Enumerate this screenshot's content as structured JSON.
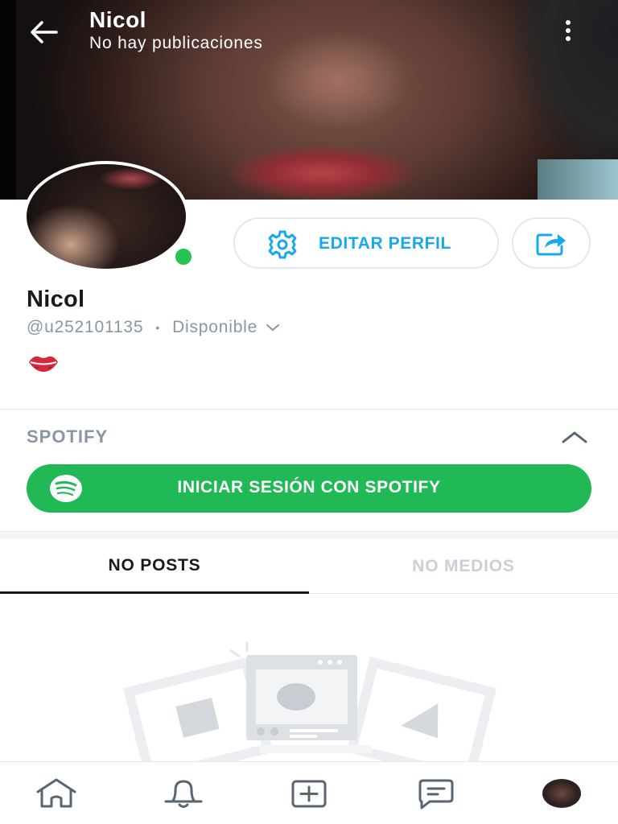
{
  "header": {
    "title": "Nicol",
    "subtitle": "No hay publicaciones",
    "back_icon": "arrow-left-icon",
    "more_icon": "more-vertical-icon"
  },
  "profile": {
    "name": "Nicol",
    "handle": "@u252101135",
    "separator": "•",
    "status": "Disponible",
    "bio_emoji": "💋",
    "online": true
  },
  "actions": {
    "edit_label": "EDITAR PERFIL",
    "edit_icon": "gear-icon",
    "share_icon": "share-icon"
  },
  "spotify": {
    "section_title": "SPOTIFY",
    "login_label": "INICIAR SESIÓN CON SPOTIFY",
    "icon": "spotify-icon"
  },
  "tabs": [
    {
      "label": "NO POSTS",
      "active": true
    },
    {
      "label": "NO MEDIOS",
      "active": false
    }
  ],
  "bottom_nav": [
    {
      "name": "home",
      "icon": "home-icon"
    },
    {
      "name": "notifications",
      "icon": "bell-icon"
    },
    {
      "name": "new-post",
      "icon": "plus-square-icon"
    },
    {
      "name": "messages",
      "icon": "chat-icon"
    },
    {
      "name": "profile",
      "icon": "avatar"
    }
  ],
  "colors": {
    "accent": "#17a9ef",
    "spotify_green": "#20b955",
    "online_green": "#27c351",
    "muted_text": "#8a96a3",
    "border": "#e2e8ee"
  }
}
